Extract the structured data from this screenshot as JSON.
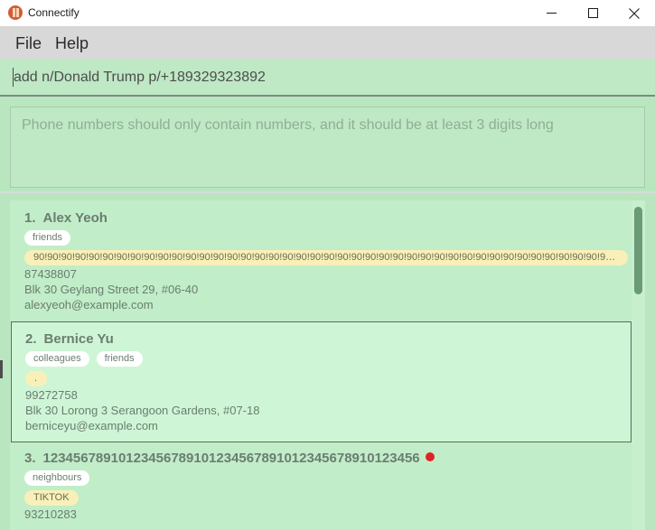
{
  "window": {
    "title": "Connectify",
    "controls": [
      "minimize-icon",
      "maximize-icon",
      "close-icon"
    ]
  },
  "menu": {
    "file": "File",
    "help": "Help"
  },
  "command_box": {
    "value": "add n/Donald Trump p/+189329323892"
  },
  "result_display": {
    "text": "Phone numbers should only contain numbers, and it should be at least 3 digits long"
  },
  "colors": {
    "background": "#b9e6bf",
    "card": "#c1edc8",
    "selected_card": "#cef6d6",
    "tag": "#ffffff",
    "social_tag": "#f8f0b8",
    "status_dot": "#e02424",
    "scroll_thumb": "#6a9a76"
  },
  "persons": [
    {
      "index": "1.",
      "name": "Alex Yeoh",
      "tags": [
        "friends"
      ],
      "social": "90!90!90!90!90!90!90!90!90!90!90!90!90!90!90!90!90!90!90!90!90!90!90!90!90!90!90!90!90!90!90!90!90!90!90!90!90!90!90!90!90!90!90!90...",
      "phone": "87438807",
      "address": "Blk 30 Geylang Street 29, #06-40",
      "email": "alexyeoh@example.com"
    },
    {
      "index": "2.",
      "name": "Bernice Yu",
      "tags": [
        "colleagues",
        "friends"
      ],
      "social": ".",
      "phone": "99272758",
      "address": "Blk 30 Lorong 3 Serangoon Gardens, #07-18",
      "email": "berniceyu@example.com"
    },
    {
      "index": "3.",
      "name": "12345678910123456789101234567891012345678910123456",
      "tags": [
        "neighbours"
      ],
      "social": "TIKTOK",
      "phone": "93210283"
    }
  ]
}
